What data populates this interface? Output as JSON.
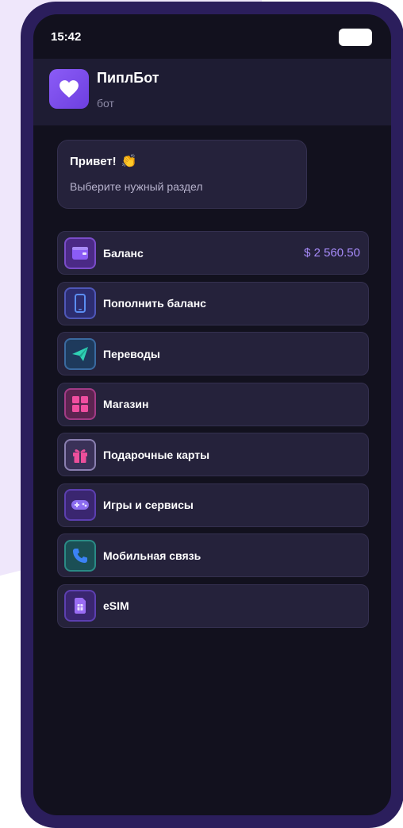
{
  "status": {
    "time": "15:42"
  },
  "header": {
    "name": "ПиплБот",
    "subtitle": "бот"
  },
  "bubble": {
    "greeting": "Привет!",
    "emoji": "👏",
    "hint": "Выберите нужный раздел"
  },
  "menu": {
    "items": [
      {
        "label": "Баланс",
        "value": "$ 2 560.50",
        "icon": "wallet-icon"
      },
      {
        "label": "Пополнить баланс",
        "icon": "phone-icon"
      },
      {
        "label": "Переводы",
        "icon": "send-icon"
      },
      {
        "label": "Магазин",
        "icon": "grid-icon"
      },
      {
        "label": "Подарочные карты",
        "icon": "gift-icon"
      },
      {
        "label": "Игры и сервисы",
        "icon": "gamepad-icon"
      },
      {
        "label": "Мобильная связь",
        "icon": "call-icon"
      },
      {
        "label": "eSIM",
        "icon": "sim-icon"
      }
    ]
  },
  "colors": {
    "accent": "#8b5cf6",
    "value": "#a78bfa",
    "screen_bg": "#12111e",
    "card_bg": "#25223b",
    "frame": "#2b1e5c"
  }
}
